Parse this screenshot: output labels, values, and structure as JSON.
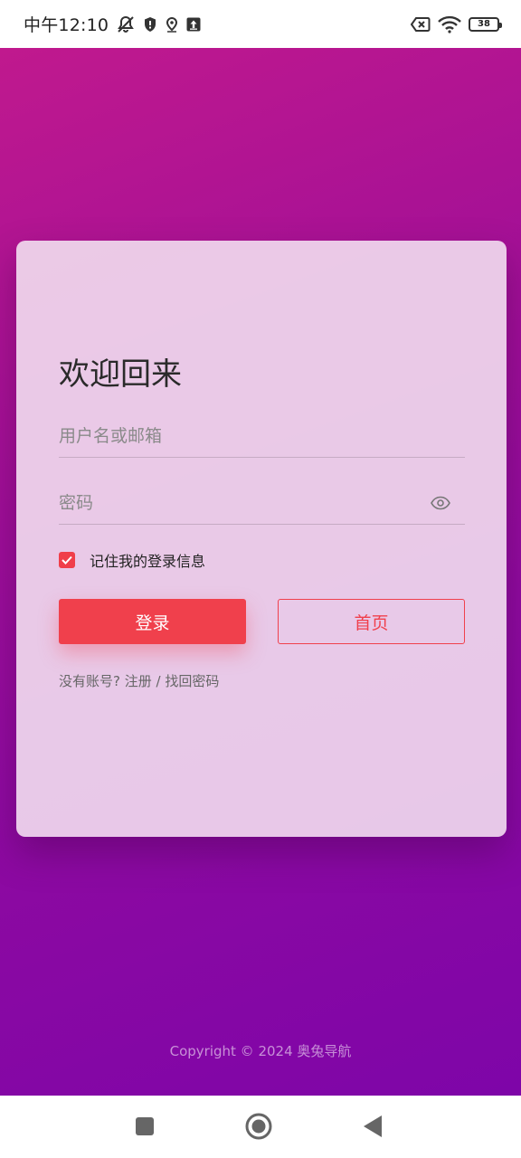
{
  "status_bar": {
    "time": "中午12:10",
    "battery": "38",
    "icons": [
      "mute-bell-icon",
      "shield-icon",
      "location-icon",
      "upload-icon",
      "sim-x-icon",
      "wifi-icon",
      "battery-icon"
    ]
  },
  "login": {
    "title": "欢迎回来",
    "username_placeholder": "用户名或邮箱",
    "password_placeholder": "密码",
    "remember_label": "记住我的登录信息",
    "remember_checked": true,
    "login_button": "登录",
    "home_button": "首页",
    "no_account_prefix": "没有账号?",
    "register_link": "注册",
    "link_separator": "/",
    "recover_link": "找回密码"
  },
  "footer": {
    "copyright": "Copyright © 2024 奥兔导航"
  },
  "colors": {
    "accent": "#f0404c",
    "gradient_start": "#c0198e",
    "gradient_end": "#7e05a8"
  },
  "nav": {
    "icons": [
      "recents-square-icon",
      "home-circle-icon",
      "back-triangle-icon"
    ]
  }
}
